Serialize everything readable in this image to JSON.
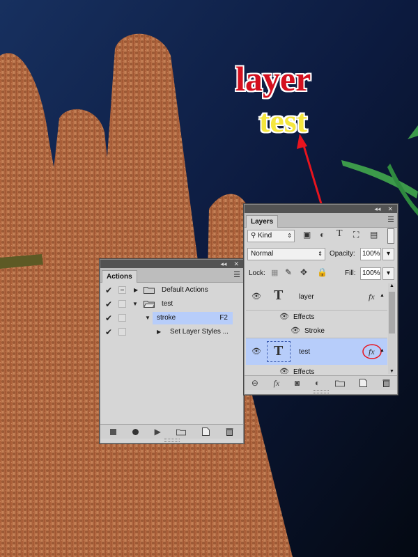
{
  "canvas": {
    "text_layer": "layer",
    "text_test": "test",
    "colors": {
      "layer_text": "#d4101f",
      "test_text": "#f5e63d",
      "arrow": "#e8141e"
    }
  },
  "actions_panel": {
    "tab": "Actions",
    "items": [
      {
        "label": "Default Actions",
        "type": "set",
        "checked": true
      },
      {
        "label": "test",
        "type": "set",
        "checked": true,
        "expanded": true
      },
      {
        "label": "stroke",
        "type": "action",
        "checked": true,
        "expanded": true,
        "selected": true,
        "shortcut": "F2"
      },
      {
        "label": "Set Layer Styles ...",
        "type": "step",
        "checked": true
      }
    ],
    "bottom_icons": [
      "stop-icon",
      "record-icon",
      "play-icon",
      "new-set-icon",
      "new-action-icon",
      "trash-icon"
    ]
  },
  "layers_panel": {
    "tab": "Layers",
    "filter_kind": "Kind",
    "blend_mode": "Normal",
    "opacity_label": "Opacity:",
    "opacity_value": "100%",
    "lock_label": "Lock:",
    "fill_label": "Fill:",
    "fill_value": "100%",
    "layers": [
      {
        "name": "layer",
        "effects_label": "Effects",
        "effect": "Stroke",
        "selected": false
      },
      {
        "name": "test",
        "effects_label": "Effects",
        "selected": true
      }
    ],
    "bottom_icons": [
      "link-icon",
      "fx-icon",
      "mask-icon",
      "adjustment-icon",
      "group-icon",
      "new-layer-icon",
      "trash-icon"
    ],
    "fx_symbol": "fx"
  }
}
